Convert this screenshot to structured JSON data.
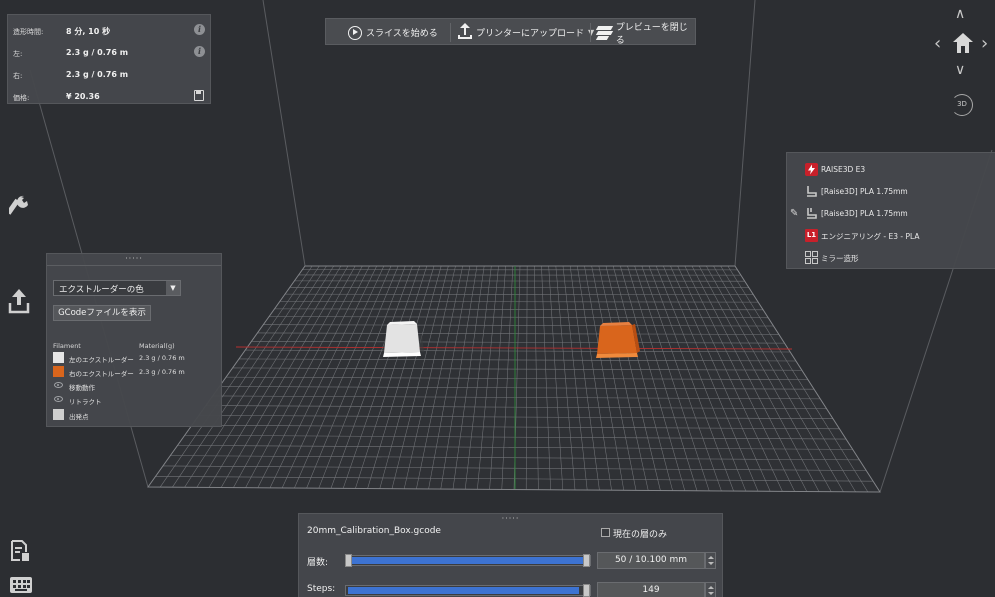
{
  "stats": {
    "rows": [
      {
        "key": "造形時間:",
        "value": "8 分, 10 秒",
        "icon": "info-icon"
      },
      {
        "key": "左:",
        "value": "2.3 g / 0.76 m",
        "icon": "info-icon"
      },
      {
        "key": "右:",
        "value": "2.3 g / 0.76 m",
        "icon": ""
      },
      {
        "key": "価格:",
        "value": "¥ 20.36",
        "icon": "save-icon"
      }
    ],
    "info_glyph": "i"
  },
  "toolbar": {
    "slice_label": "スライスを始める",
    "upload_label": "プリンターにアップロード",
    "close_preview_label": "プレビューを閉じる",
    "dropdown_caret": "▼"
  },
  "camera": {
    "up": "∧",
    "down": "∨",
    "left": "‹",
    "right": "›",
    "view3d": "3D"
  },
  "legend": {
    "drag_handle": "·····",
    "color_mode": "エクストルーダーの色",
    "select_arrow": "▼",
    "show_gcode": "GCodeファイルを表示",
    "header_filament": "Filament",
    "header_material": "Material(g)",
    "rows": [
      {
        "name": "左のエクストルーダー",
        "value": "2.3 g / 0.76 m",
        "type": "swatch",
        "color": "#e6e6e6"
      },
      {
        "name": "右のエクストルーダー",
        "value": "2.3 g / 0.76 m",
        "type": "swatch",
        "color": "#d9651c"
      },
      {
        "name": "移動動作",
        "value": "",
        "type": "eye"
      },
      {
        "name": "リトラクト",
        "value": "",
        "type": "eye"
      },
      {
        "name": "出発点",
        "value": "",
        "type": "swatch",
        "color": "#cfcfcf"
      }
    ]
  },
  "machine": {
    "printer": "RAISE3D E3",
    "material_left": "[Raise3D] PLA 1.75mm",
    "material_right": "[Raise3D] PLA 1.75mm",
    "profile_badge": "L1",
    "profile": "エンジニアリング - E3 - PLA",
    "mode": "ミラー造形",
    "pen_glyph": "✎"
  },
  "layers": {
    "drag_handle": "·····",
    "filename": "20mm_Calibration_Box.gcode",
    "current_only": "現在の層のみ",
    "layer_label": "層数:",
    "layer_value": "50 / 10.100 mm",
    "steps_label": "Steps:",
    "steps_value": "149",
    "layer_progress": 1.0,
    "steps_progress": 1.0
  },
  "colors": {
    "accent_blue": "#3d73d2",
    "model_white": "#e6e6e6",
    "model_orange": "#d9651c",
    "printer_red": "#c8202a",
    "background": "#2c2e32",
    "panel": "#46484c"
  }
}
